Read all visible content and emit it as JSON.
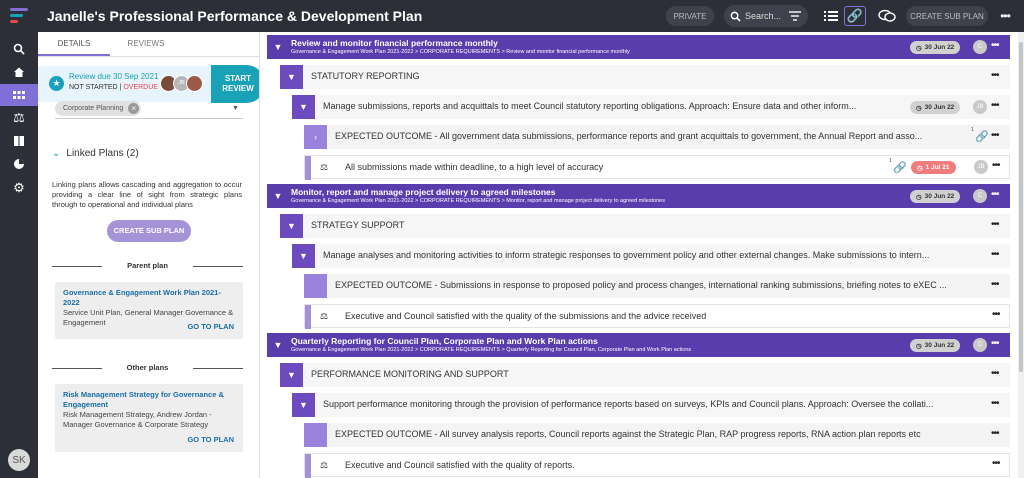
{
  "app": {
    "title": "Janelle's Professional Performance & Development Plan"
  },
  "topbar": {
    "private_label": "PRIVATE",
    "search_placeholder": "Search...",
    "create_sub_plan": "CREATE SUB PLAN"
  },
  "tabs": [
    "DETAILS",
    "REVIEWS"
  ],
  "review": {
    "due": "Review due 30 Sep 2021",
    "status": "NOT STARTED",
    "sep": " | ",
    "overdue": "OVERDUE",
    "avatar_initials": "JB",
    "start_line1": "START",
    "start_line2": "REVIEW"
  },
  "tag": {
    "label": "Corporate Planning",
    "remove": "×"
  },
  "linked_plans": {
    "title": "Linked Plans (2)",
    "description": "Linking plans allows cascading and aggregation to occur providing a clear line of sight from strategic plans through to operational and individual plans",
    "create_button": "CREATE SUB PLAN"
  },
  "parent_plan": {
    "heading": "Parent plan",
    "title": "Governance & Engagement Work Plan 2021-2022",
    "subtitle": "Service Unit Plan, General Manager Governance & Engagement",
    "go": "GO TO PLAN"
  },
  "other_plans": {
    "heading": "Other plans",
    "title": "Risk Management Strategy for Governance & Engagement",
    "subtitle": "Risk Management Strategy, Andrew Jordan - Manager Governance & Corporate Strategy",
    "go": "GO TO PLAN"
  },
  "sections": [
    {
      "title": "Review and monitor financial performance monthly",
      "path": "Governance & Engagement Work Plan 2021-2022 > CORPORATE REQUIREMENTS > Review and monitor financial performance monthly",
      "date": "30 Jun 22",
      "owner": "C",
      "group": "STATUTORY REPORTING",
      "action": "Manage submissions, reports and acquittals to meet Council statutory reporting obligations. Approach: Ensure data and other inform...",
      "action_date": "30 Jun 22",
      "action_owner": "JB",
      "outcome": "EXPECTED OUTCOME - All government data submissions, performance reports and grant acquittals to government, the Annual Report and asso...",
      "outcome_links": "1",
      "kpi": "All submissions made within deadline, to a high level of accuracy",
      "kpi_links": "1",
      "kpi_date": "1 Jul 21",
      "kpi_owner": "JB"
    },
    {
      "title": "Monitor, report and manage project delivery to agreed milestones",
      "path": "Governance & Engagement Work Plan 2021-2022 > CORPORATE REQUIREMENTS > Monitor, report and manage project delivery to agreed milestones",
      "date": "30 Jun 22",
      "owner": "C",
      "group": "STRATEGY SUPPORT",
      "action": "Manage analyses and monitoring activities to inform strategic responses to government policy and other external changes. Make submissions to intern...",
      "outcome": "EXPECTED OUTCOME - Submissions in response to proposed policy and process changes, international ranking submissions, briefing notes to eXEC ...",
      "kpi": "Executive and Council satisfied with the quality of the submissions and the advice received"
    },
    {
      "title": "Quarterly Reporting for Council Plan, Corporate Plan and Work Plan actions",
      "path": "Governance & Engagement Work Plan 2021-2022 > CORPORATE REQUIREMENTS > Quarterly Reporting for Council Plan, Corporate Plan and Work Plan actions",
      "date": "30 Jun 22",
      "owner": "C",
      "group": "PERFORMANCE MONITORING AND SUPPORT",
      "action": "Support performance monitoring through the provision of performance reports based on surveys, KPIs and Council plans. Approach: Oversee the collati...",
      "outcome": "EXPECTED OUTCOME - All survey analysis reports, Council reports against the Strategic Plan, RAP progress reports, RNA action plan reports etc",
      "kpi": "Executive and Council satisfied with the quality of reports."
    }
  ],
  "user": {
    "initials": "SK"
  },
  "colors": {
    "accent": "#5a3dac",
    "teal": "#18a2b8",
    "overdue": "#e5484d"
  }
}
